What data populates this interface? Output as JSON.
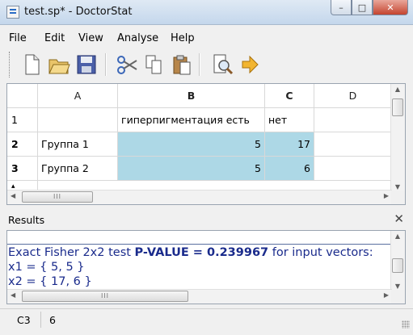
{
  "window": {
    "title": "test.sp* - DoctorStat"
  },
  "menu": {
    "items": [
      "File",
      "Edit",
      "View",
      "Analyse",
      "Help"
    ]
  },
  "toolbar": {
    "buttons": [
      "new-file-icon",
      "open-folder-icon",
      "save-icon",
      "cut-icon",
      "copy-icon",
      "paste-icon",
      "print-preview-icon",
      "arrow-right-icon"
    ]
  },
  "sheet": {
    "columns": [
      "A",
      "B",
      "C",
      "D"
    ],
    "rows": [
      {
        "num": "1",
        "cells": [
          "",
          "гиперпигментация есть",
          "нет",
          ""
        ]
      },
      {
        "num": "2",
        "cells": [
          "Группа 1",
          "5",
          "17",
          ""
        ]
      },
      {
        "num": "3",
        "cells": [
          "Группа 2",
          "5",
          "6",
          ""
        ]
      }
    ]
  },
  "results": {
    "title": "Results",
    "line1_prefix": "Exact Fisher 2x2 test ",
    "line1_pvalue_label": "P-VALUE = 0.239967",
    "line1_suffix": " for input vectors:",
    "line2": "x1 = { 5, 5 }",
    "line3": "x2 = { 17, 6 }"
  },
  "status": {
    "cell": "C3",
    "value": "6"
  },
  "colors": {
    "selection": "#add8e6",
    "results_text": "#1a2b8c"
  }
}
